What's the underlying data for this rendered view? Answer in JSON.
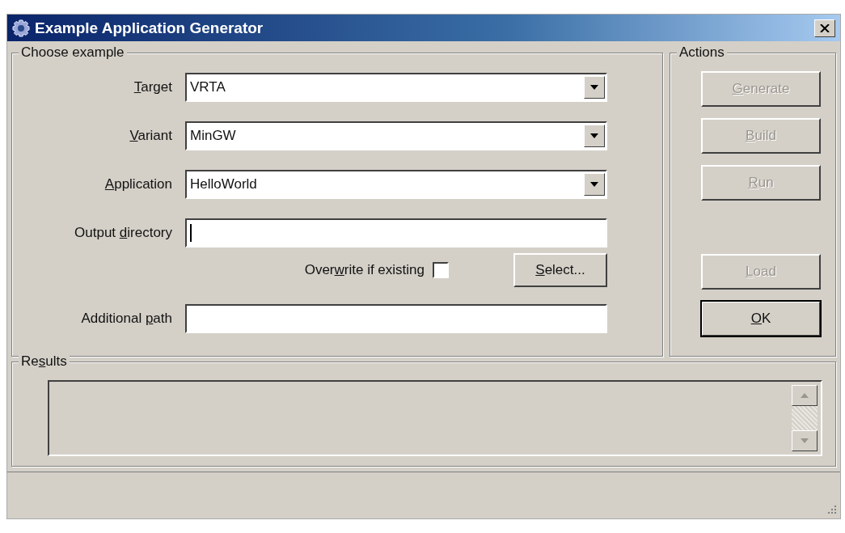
{
  "window": {
    "title": "Example Application Generator"
  },
  "choose_example": {
    "legend": {
      "pre": "Choose example"
    },
    "fields": [
      {
        "kind": "dropdown",
        "label": {
          "key": "T",
          "post": "arget"
        },
        "value": "VRTA"
      },
      {
        "kind": "dropdown",
        "label": {
          "key": "V",
          "post": "ariant"
        },
        "value": "MinGW"
      },
      {
        "kind": "dropdown",
        "label": {
          "key": "A",
          "post": "pplication"
        },
        "value": "HelloWorld"
      },
      {
        "kind": "text",
        "label": {
          "pre": "Output ",
          "key": "d",
          "post": "irectory"
        },
        "focused": true
      },
      {
        "kind": "checkbox",
        "label": {
          "pre": "Over",
          "key": "w",
          "post": "rite if existing"
        },
        "checked": false,
        "button": {
          "key": "S",
          "post": "elect..."
        }
      },
      {
        "kind": "text",
        "label": {
          "pre": "Additional ",
          "key": "p",
          "post": "ath"
        },
        "focused": false
      }
    ]
  },
  "actions": {
    "legend": {
      "pre": "Actions"
    },
    "buttons": [
      {
        "label": {
          "key": "G",
          "post": "enerate"
        },
        "disabled": true,
        "default": false
      },
      {
        "label": {
          "key": "B",
          "post": "uild"
        },
        "disabled": true,
        "default": false
      },
      {
        "label": {
          "key": "R",
          "post": "un"
        },
        "disabled": true,
        "default": false
      },
      {
        "label": {
          "key": "L",
          "post": "oad"
        },
        "disabled": true,
        "default": false
      },
      {
        "label": {
          "key": "O",
          "post": "K"
        },
        "disabled": false,
        "default": true
      }
    ]
  },
  "results": {
    "legend": {
      "pre": "Re",
      "key": "s",
      "post": "ults"
    }
  }
}
